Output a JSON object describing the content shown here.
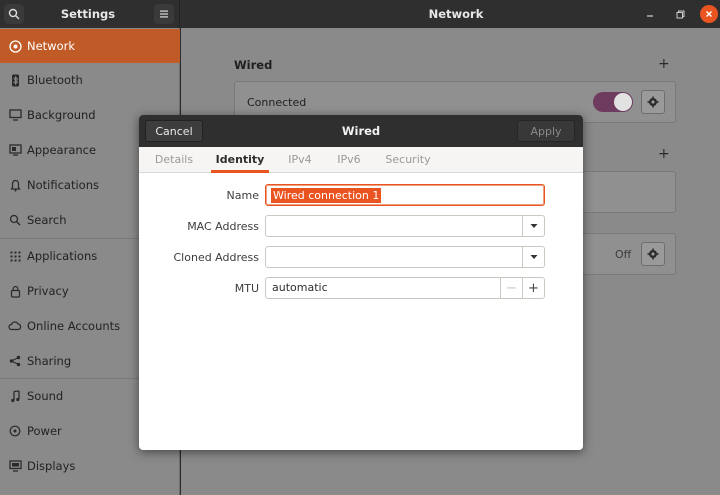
{
  "titlebar": {
    "settings_title": "Settings",
    "page_title": "Network"
  },
  "sidebar": {
    "items": [
      {
        "label": "Network",
        "icon": "network-icon"
      },
      {
        "label": "Bluetooth",
        "icon": "bluetooth-icon"
      },
      {
        "label": "Background",
        "icon": "monitor-icon"
      },
      {
        "label": "Appearance",
        "icon": "appearance-icon"
      },
      {
        "label": "Notifications",
        "icon": "bell-icon"
      },
      {
        "label": "Search",
        "icon": "search-icon"
      },
      {
        "label": "Applications",
        "icon": "grid-icon"
      },
      {
        "label": "Privacy",
        "icon": "lock-icon"
      },
      {
        "label": "Online Accounts",
        "icon": "cloud-icon"
      },
      {
        "label": "Sharing",
        "icon": "share-icon"
      },
      {
        "label": "Sound",
        "icon": "music-note-icon"
      },
      {
        "label": "Power",
        "icon": "power-icon"
      },
      {
        "label": "Displays",
        "icon": "display-icon"
      }
    ]
  },
  "main": {
    "wired_section_title": "Wired",
    "wired_status": "Connected",
    "plus_glyph": "+",
    "vpn_status": "Off"
  },
  "dialog": {
    "title": "Wired",
    "cancel_label": "Cancel",
    "apply_label": "Apply",
    "tabs": [
      "Details",
      "Identity",
      "IPv4",
      "IPv6",
      "Security"
    ],
    "active_tab": "Identity",
    "form": {
      "name_label": "Name",
      "name_value": "Wired connection 1",
      "mac_label": "MAC Address",
      "mac_value": "",
      "cloned_label": "Cloned Address",
      "cloned_value": "",
      "mtu_label": "MTU",
      "mtu_value": "automatic",
      "minus_glyph": "−",
      "plus_glyph": "+"
    }
  },
  "colors": {
    "accent": "#e95420",
    "toggle_on": "#77216f",
    "headerbar": "#2f2f2f"
  }
}
